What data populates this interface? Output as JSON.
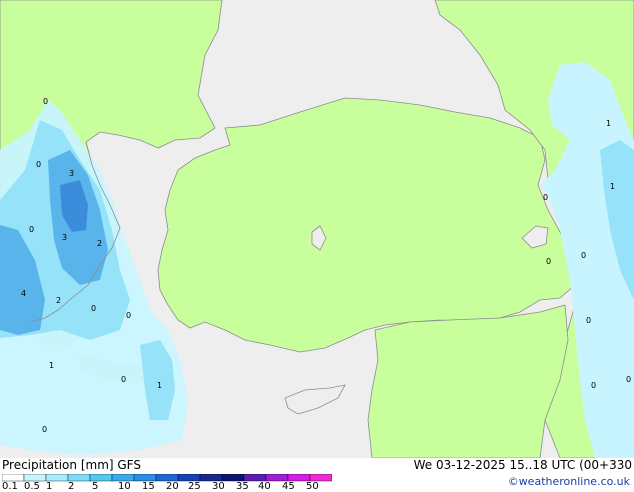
{
  "map": {
    "colors": {
      "sea": "#eeeeee",
      "land": "#c8ff9c",
      "border": "#8c8c8c",
      "precip_light": "#c8f4ff",
      "precip_mid": "#96e2f8",
      "precip_heavy": "#5ab4ec",
      "precip_strong": "#3c8cdc"
    },
    "labels": [
      {
        "text": "0"
      },
      {
        "text": "0"
      },
      {
        "text": "3"
      },
      {
        "text": "0"
      },
      {
        "text": "3"
      },
      {
        "text": "2"
      },
      {
        "text": "4"
      },
      {
        "text": "2"
      },
      {
        "text": "0"
      },
      {
        "text": "0"
      },
      {
        "text": "1"
      },
      {
        "text": "0"
      },
      {
        "text": "1"
      },
      {
        "text": "0"
      },
      {
        "text": "1"
      },
      {
        "text": "1"
      },
      {
        "text": "0"
      },
      {
        "text": "0"
      },
      {
        "text": "0"
      },
      {
        "text": "0"
      },
      {
        "text": "0"
      },
      {
        "text": "0"
      }
    ]
  },
  "footer": {
    "title": "Precipitation [mm]  GFS",
    "datetime": "We 03-12-2025 15..18 UTC (00+330",
    "credit": "©weatheronline.co.uk",
    "scale": {
      "colors": [
        "#ffffff",
        "#c8f4ff",
        "#a8ecfc",
        "#7edcf6",
        "#56c8f0",
        "#3aaaee",
        "#2c8ce6",
        "#2066d2",
        "#1a40b4",
        "#142a8e",
        "#0c1470",
        "#5a1eb4",
        "#9e1ed2",
        "#d21ee6",
        "#ee2ad2",
        "#d22aaa"
      ],
      "ticks": [
        "0.1",
        "0.5",
        "1",
        "2",
        "5",
        "10",
        "15",
        "20",
        "25",
        "30",
        "35",
        "40",
        "45",
        "50"
      ]
    }
  }
}
